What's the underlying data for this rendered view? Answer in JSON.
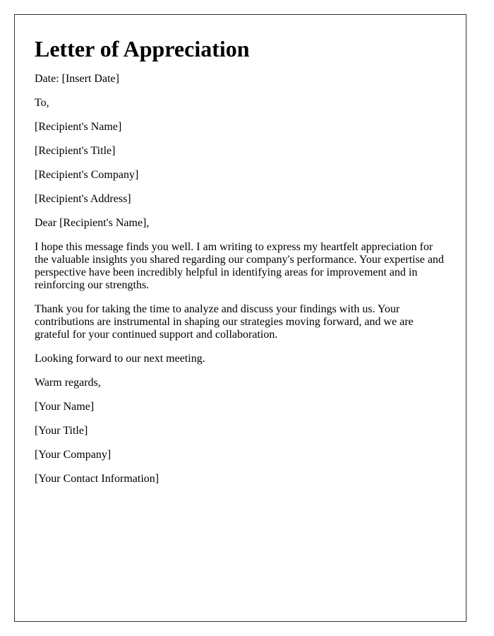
{
  "letter": {
    "title": "Letter of Appreciation",
    "date_line": "Date: [Insert Date]",
    "to_line": "To,",
    "recipient": {
      "name": "[Recipient's Name]",
      "title": "[Recipient's Title]",
      "company": "[Recipient's Company]",
      "address": "[Recipient's Address]"
    },
    "salutation": "Dear [Recipient's Name],",
    "body": [
      "I hope this message finds you well. I am writing to express my heartfelt appreciation for the valuable insights you shared regarding our company's performance. Your expertise and perspective have been incredibly helpful in identifying areas for improvement and in reinforcing our strengths.",
      "Thank you for taking the time to analyze and discuss your findings with us. Your contributions are instrumental in shaping our strategies moving forward, and we are grateful for your continued support and collaboration.",
      "Looking forward to our next meeting."
    ],
    "closing": "Warm regards,",
    "sender": {
      "name": "[Your Name]",
      "title": "[Your Title]",
      "company": "[Your Company]",
      "contact": "[Your Contact Information]"
    }
  }
}
